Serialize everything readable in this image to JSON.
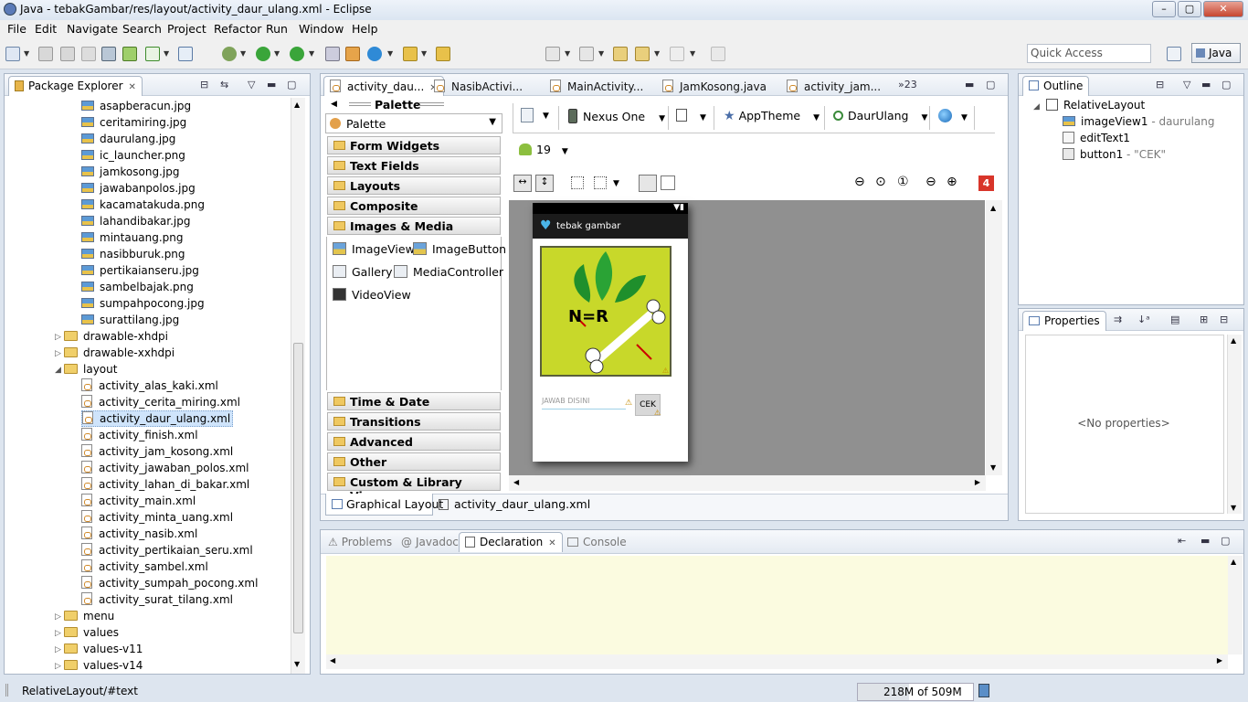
{
  "window": {
    "title": "Java - tebakGambar/res/layout/activity_daur_ulang.xml - Eclipse",
    "buttons": [
      "–",
      "▢",
      "✕"
    ]
  },
  "menubar": [
    "File",
    "Edit",
    "Navigate",
    "Search",
    "Project",
    "Refactor",
    "Run",
    "Window",
    "Help"
  ],
  "toolbar": {
    "quick_access_placeholder": "Quick Access",
    "perspective_label": "Java"
  },
  "package_explorer": {
    "title": "Package Explorer",
    "items": [
      {
        "label": "asapberacun.jpg",
        "type": "image",
        "indent": 2
      },
      {
        "label": "ceritamiring.jpg",
        "type": "image",
        "indent": 2
      },
      {
        "label": "daurulang.jpg",
        "type": "image",
        "indent": 2
      },
      {
        "label": "ic_launcher.png",
        "type": "image",
        "indent": 2
      },
      {
        "label": "jamkosong.jpg",
        "type": "image",
        "indent": 2
      },
      {
        "label": "jawabanpolos.jpg",
        "type": "image",
        "indent": 2
      },
      {
        "label": "kacamatakuda.png",
        "type": "image",
        "indent": 2
      },
      {
        "label": "lahandibakar.jpg",
        "type": "image",
        "indent": 2
      },
      {
        "label": "mintauang.png",
        "type": "image",
        "indent": 2
      },
      {
        "label": "nasibburuk.png",
        "type": "image",
        "indent": 2
      },
      {
        "label": "pertikaianseru.jpg",
        "type": "image",
        "indent": 2
      },
      {
        "label": "sambelbajak.png",
        "type": "image",
        "indent": 2
      },
      {
        "label": "sumpahpocong.jpg",
        "type": "image",
        "indent": 2
      },
      {
        "label": "surattilang.jpg",
        "type": "image",
        "indent": 2
      },
      {
        "label": "drawable-xhdpi",
        "type": "folder",
        "indent": 1,
        "toggle": "▷"
      },
      {
        "label": "drawable-xxhdpi",
        "type": "folder",
        "indent": 1,
        "toggle": "▷"
      },
      {
        "label": "layout",
        "type": "folder",
        "indent": 1,
        "toggle": "◢"
      },
      {
        "label": "activity_alas_kaki.xml",
        "type": "xml",
        "indent": 2
      },
      {
        "label": "activity_cerita_miring.xml",
        "type": "xml",
        "indent": 2
      },
      {
        "label": "activity_daur_ulang.xml",
        "type": "xml",
        "indent": 2,
        "selected": true
      },
      {
        "label": "activity_finish.xml",
        "type": "xml",
        "indent": 2
      },
      {
        "label": "activity_jam_kosong.xml",
        "type": "xml",
        "indent": 2
      },
      {
        "label": "activity_jawaban_polos.xml",
        "type": "xml",
        "indent": 2
      },
      {
        "label": "activity_lahan_di_bakar.xml",
        "type": "xml",
        "indent": 2
      },
      {
        "label": "activity_main.xml",
        "type": "xml",
        "indent": 2
      },
      {
        "label": "activity_minta_uang.xml",
        "type": "xml",
        "indent": 2
      },
      {
        "label": "activity_nasib.xml",
        "type": "xml",
        "indent": 2
      },
      {
        "label": "activity_pertikaian_seru.xml",
        "type": "xml",
        "indent": 2
      },
      {
        "label": "activity_sambel.xml",
        "type": "xml",
        "indent": 2
      },
      {
        "label": "activity_sumpah_pocong.xml",
        "type": "xml",
        "indent": 2
      },
      {
        "label": "activity_surat_tilang.xml",
        "type": "xml",
        "indent": 2
      },
      {
        "label": "menu",
        "type": "folder",
        "indent": 1,
        "toggle": "▷"
      },
      {
        "label": "values",
        "type": "folder",
        "indent": 1,
        "toggle": "▷"
      },
      {
        "label": "values-v11",
        "type": "folder",
        "indent": 1,
        "toggle": "▷"
      },
      {
        "label": "values-v14",
        "type": "folder",
        "indent": 1,
        "toggle": "▷"
      }
    ]
  },
  "editor": {
    "tabs": [
      {
        "label": "activity_dau...",
        "active": true
      },
      {
        "label": "NasibActivi...",
        "active": false
      },
      {
        "label": "MainActivity...",
        "active": false
      },
      {
        "label": "JamKosong.java",
        "active": false
      },
      {
        "label": "activity_jam...",
        "active": false
      }
    ],
    "overflow_label": "»23",
    "palette": {
      "header": "Palette",
      "dropdown": "Palette",
      "categories_top": [
        "Form Widgets",
        "Text Fields",
        "Layouts",
        "Composite",
        "Images & Media"
      ],
      "widgets": [
        "ImageView",
        "ImageButton",
        "Gallery",
        "MediaController",
        "VideoView"
      ],
      "categories_bottom": [
        "Time & Date",
        "Transitions",
        "Advanced",
        "Other",
        "Custom & Library Views"
      ]
    },
    "config": {
      "device": "Nexus One",
      "theme": "AppTheme",
      "activity": "DaurUlang",
      "api_level": "19",
      "error_count": "4"
    },
    "preview": {
      "app_title": "tebak gambar",
      "image_text": "N=R",
      "edittext_hint": "JAWAB DISINI",
      "button_label": "CEK"
    },
    "bottom_tabs": [
      "Graphical Layout",
      "activity_daur_ulang.xml"
    ]
  },
  "outline": {
    "title": "Outline",
    "root": "RelativeLayout",
    "children": [
      {
        "name": "imageView1",
        "detail": " - daurulang"
      },
      {
        "name": "editText1",
        "detail": ""
      },
      {
        "name": "button1",
        "detail": " - \"CEK\""
      }
    ]
  },
  "properties": {
    "title": "Properties",
    "empty_text": "<No properties>"
  },
  "bottom_panel": {
    "tabs": [
      "Problems",
      "Javadoc",
      "Declaration",
      "Console"
    ],
    "active": "Declaration"
  },
  "statusbar": {
    "text": "RelativeLayout/#text",
    "heap": "218M of 509M"
  },
  "colors": {
    "accent_selected": "#cfe4fb",
    "preview_image_bg": "#c8d82a",
    "actionbar": "#1b1b1b",
    "declaration_bg": "#fbfbe0"
  }
}
